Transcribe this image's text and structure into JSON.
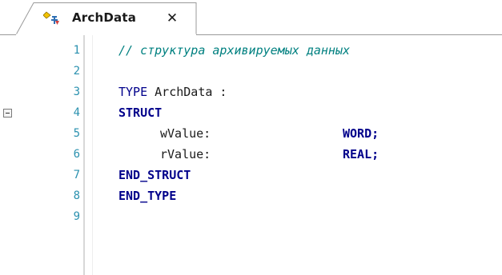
{
  "tab": {
    "title": "ArchData",
    "close_glyph": "✕",
    "icon": "dut-icon"
  },
  "editor": {
    "lines": [
      {
        "num": "1",
        "text": "// структура архивируемых данных"
      },
      {
        "num": "2",
        "text": ""
      },
      {
        "num": "3",
        "kw1": "TYPE",
        "ident": " ArchData :"
      },
      {
        "num": "4",
        "text": "STRUCT"
      },
      {
        "num": "5",
        "field": "wValue:",
        "type": "WORD;"
      },
      {
        "num": "6",
        "field": "rValue:",
        "type": "REAL;"
      },
      {
        "num": "7",
        "text": "END_STRUCT"
      },
      {
        "num": "8",
        "text": "END_TYPE"
      },
      {
        "num": "9",
        "text": ""
      }
    ]
  },
  "colors": {
    "line_number": "#2b91af",
    "comment": "#008080",
    "keyword": "#00008b"
  }
}
